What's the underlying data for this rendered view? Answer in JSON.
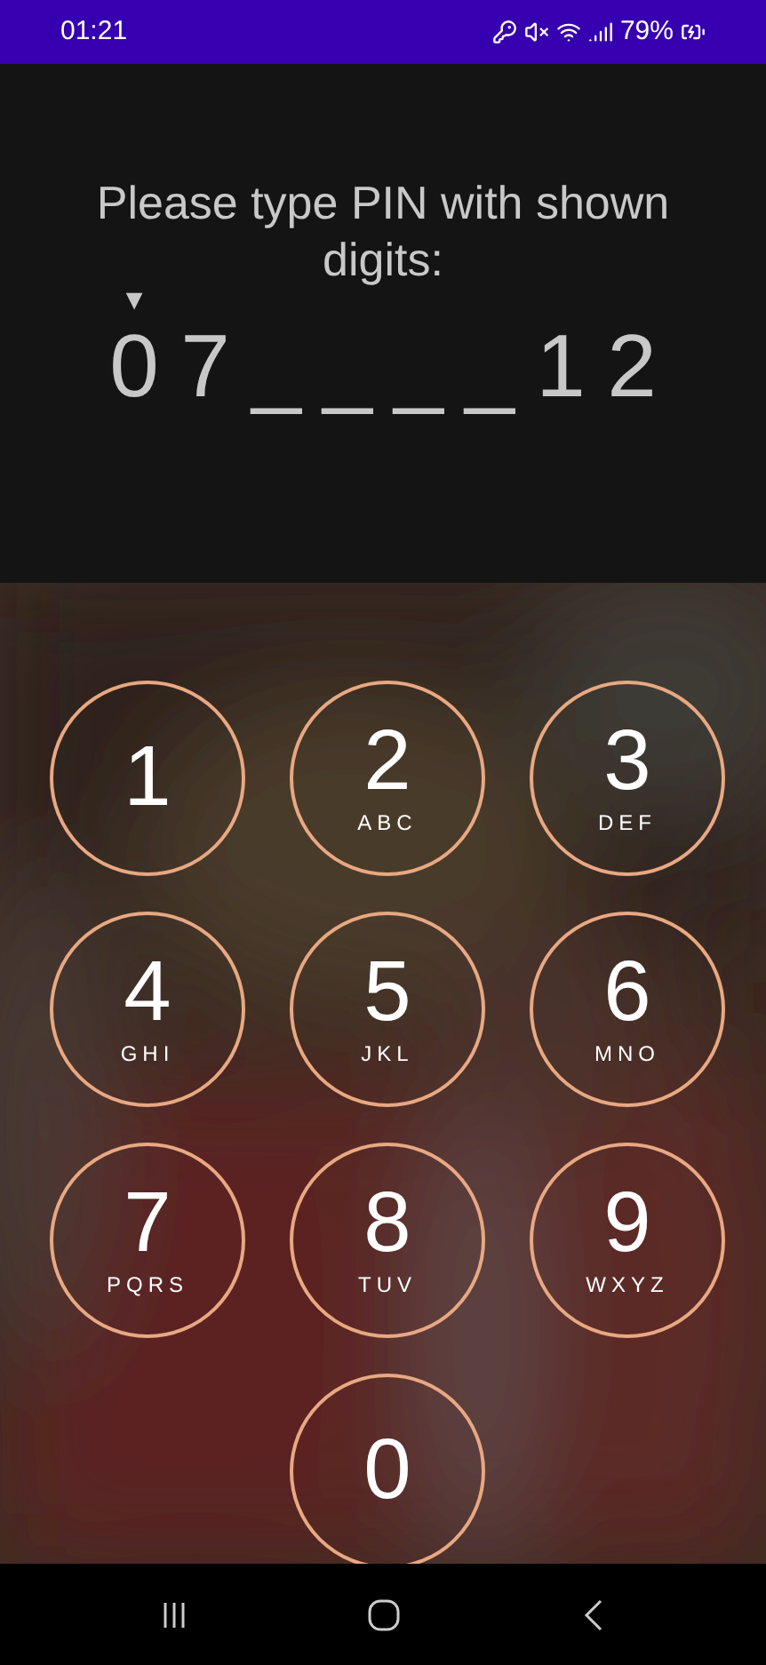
{
  "status_bar": {
    "time": "01:21",
    "battery": "79%"
  },
  "prompt": "Please type PIN with shown digits:",
  "marker": "▼",
  "pin_slots": [
    {
      "text": "0",
      "selected": true
    },
    {
      "text": "7",
      "selected": false
    },
    {
      "text": "_",
      "selected": false
    },
    {
      "text": "_",
      "selected": false
    },
    {
      "text": "_",
      "selected": false
    },
    {
      "text": "_",
      "selected": false
    },
    {
      "text": "1",
      "selected": false
    },
    {
      "text": "2",
      "selected": false
    }
  ],
  "keypad": [
    {
      "digit": "1"
    },
    {
      "digit": "2",
      "letters": "ABC"
    },
    {
      "digit": "3",
      "letters": "DEF"
    },
    {
      "digit": "4",
      "letters": "GHI"
    },
    {
      "digit": "5",
      "letters": "JKL"
    },
    {
      "digit": "6",
      "letters": "MNO"
    },
    {
      "digit": "7",
      "letters": "PQRS"
    },
    {
      "digit": "8",
      "letters": "TUV"
    },
    {
      "digit": "9",
      "letters": "WXYZ"
    },
    {
      "digit": "0"
    }
  ]
}
